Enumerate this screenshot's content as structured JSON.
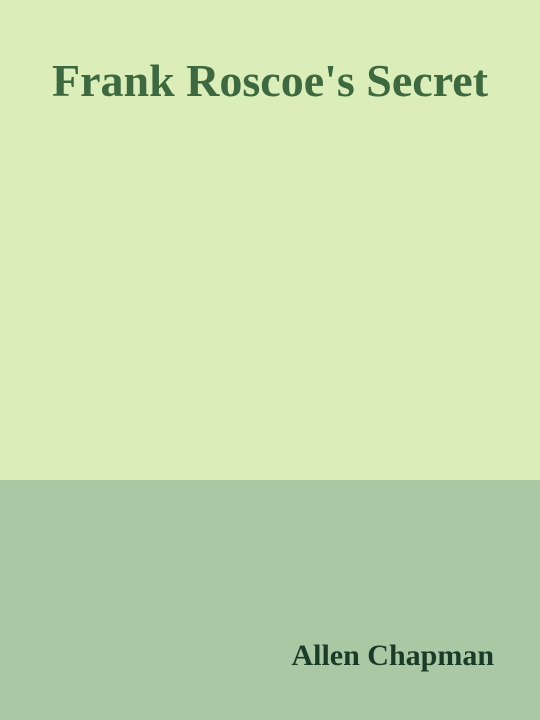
{
  "book": {
    "title": "Frank Roscoe's Secret",
    "author": "Allen Chapman"
  },
  "colors": {
    "top_background": "#dbeeb9",
    "bottom_background": "#abc8a5",
    "title_text": "#3e6840",
    "author_text": "#1b3b29"
  }
}
